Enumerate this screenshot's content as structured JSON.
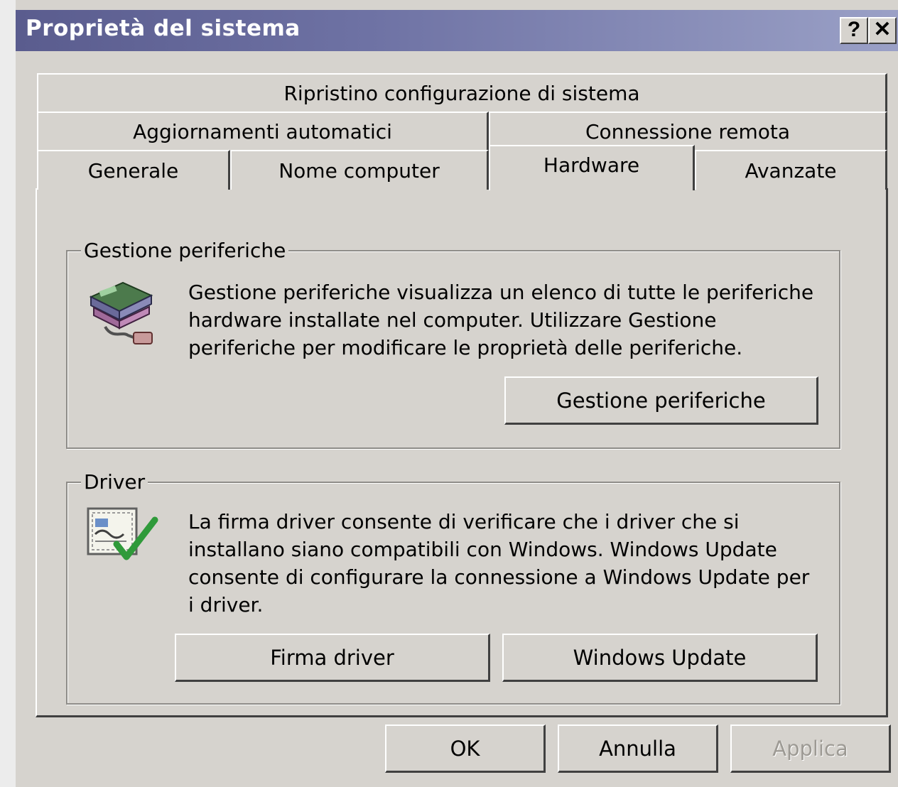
{
  "window": {
    "title": "Proprietà del sistema",
    "help_button": "?",
    "close_button": "✕"
  },
  "tabs": {
    "row1": [
      "Ripristino configurazione di sistema"
    ],
    "row2": [
      "Aggiornamenti automatici",
      "Connessione remota"
    ],
    "row3": [
      "Generale",
      "Nome computer",
      "Hardware",
      "Avanzate"
    ],
    "active": "Hardware"
  },
  "device_manager": {
    "group_label": "Gestione periferiche",
    "description": "Gestione periferiche visualizza un elenco di tutte le periferiche hardware installate nel computer. Utilizzare Gestione periferiche per modificare le proprietà delle periferiche.",
    "button_label": "Gestione periferiche",
    "icon": "device-manager-icon"
  },
  "driver": {
    "group_label": "Driver",
    "description": "La firma driver consente di verificare che i driver che si installano siano compatibili con Windows. Windows Update consente di configurare la connessione a Windows Update per i driver.",
    "signing_button": "Firma driver",
    "update_button": "Windows Update",
    "icon": "driver-signing-icon"
  },
  "footer": {
    "ok": "OK",
    "cancel": "Annulla",
    "apply": "Applica"
  }
}
